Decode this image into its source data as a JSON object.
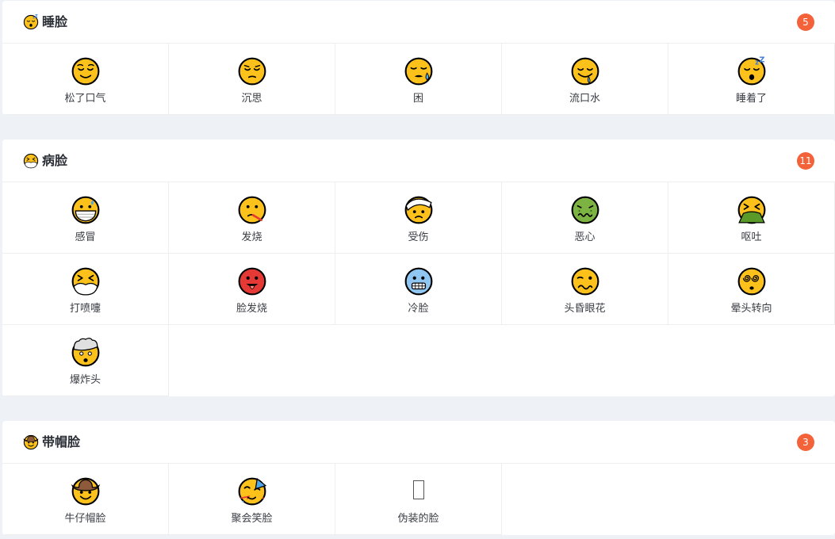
{
  "sections": [
    {
      "id": "sleepy",
      "title": "睡脸",
      "icon": "sleeping-face-icon",
      "count": "5",
      "items": [
        {
          "label": "松了口气",
          "icon": "relieved-face-icon"
        },
        {
          "label": "沉思",
          "icon": "pensive-face-icon"
        },
        {
          "label": "困",
          "icon": "sleepy-face-icon"
        },
        {
          "label": "流口水",
          "icon": "drooling-face-icon"
        },
        {
          "label": "睡着了",
          "icon": "sleeping-face-icon"
        }
      ]
    },
    {
      "id": "sick",
      "title": "病脸",
      "icon": "sneezing-face-icon",
      "count": "11",
      "items": [
        {
          "label": "感冒",
          "icon": "face-with-medical-mask-icon"
        },
        {
          "label": "发烧",
          "icon": "face-with-thermometer-icon"
        },
        {
          "label": "受伤",
          "icon": "face-with-head-bandage-icon"
        },
        {
          "label": "恶心",
          "icon": "nauseated-face-icon"
        },
        {
          "label": "呕吐",
          "icon": "vomiting-face-icon"
        },
        {
          "label": "打喷嚏",
          "icon": "sneezing-face-icon"
        },
        {
          "label": "脸发烧",
          "icon": "hot-face-icon"
        },
        {
          "label": "冷脸",
          "icon": "cold-face-icon"
        },
        {
          "label": "头昏眼花",
          "icon": "woozy-face-icon"
        },
        {
          "label": "晕头转向",
          "icon": "face-with-spiral-eyes-icon"
        },
        {
          "label": "爆炸头",
          "icon": "exploding-head-icon"
        }
      ]
    },
    {
      "id": "hat",
      "title": "带帽脸",
      "icon": "cowboy-hat-face-icon",
      "count": "3",
      "items": [
        {
          "label": "牛仔帽脸",
          "icon": "cowboy-hat-face-icon"
        },
        {
          "label": "聚会笑脸",
          "icon": "partying-face-icon"
        },
        {
          "label": "伪装的脸",
          "icon": "missing-glyph-icon"
        }
      ]
    }
  ]
}
